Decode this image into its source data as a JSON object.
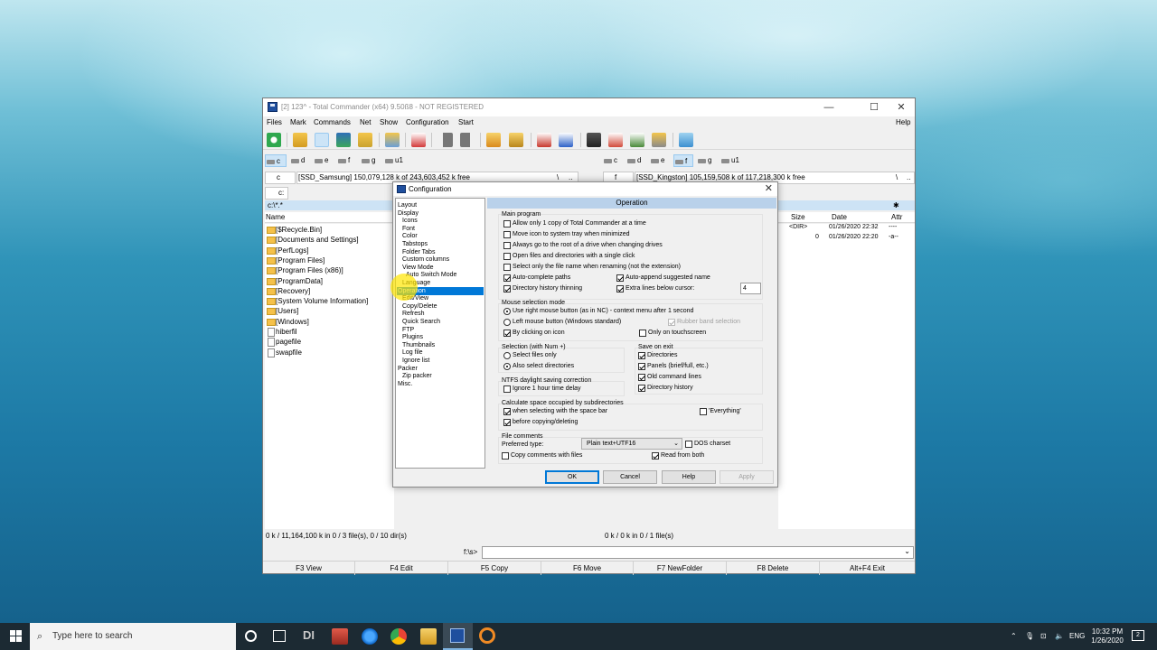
{
  "window": {
    "title": "[2] 123^ - Total Commander (x64) 9.50ß8 - NOT REGISTERED",
    "min_glyph": "—",
    "max_glyph": "☐",
    "close_glyph": "✕"
  },
  "menu": [
    "Files",
    "Mark",
    "Commands",
    "Net",
    "Show",
    "Configuration",
    "Start"
  ],
  "menu_help": "Help",
  "left_drives": [
    "c",
    "d",
    "e",
    "f",
    "g",
    "u1"
  ],
  "right_drives": [
    "c",
    "d",
    "e",
    "f",
    "g",
    "u1"
  ],
  "left_panel": {
    "drive_select": "c",
    "info": "[SSD_Samsung]  150,079,128 k of 243,603,452 k free",
    "root_btn": "\\",
    "up_btn": "..",
    "tab": "c:",
    "path": "c:\\*.*",
    "col_name": "Name",
    "files": [
      {
        "name": "[$Recycle.Bin]",
        "kind": "dir"
      },
      {
        "name": "[Documents and Settings]",
        "kind": "dir"
      },
      {
        "name": "[PerfLogs]",
        "kind": "dir"
      },
      {
        "name": "[Program Files]",
        "kind": "dir"
      },
      {
        "name": "[Program Files (x86)]",
        "kind": "dir"
      },
      {
        "name": "[ProgramData]",
        "kind": "dir"
      },
      {
        "name": "[Recovery]",
        "kind": "dir"
      },
      {
        "name": "[System Volume Information]",
        "kind": "dir"
      },
      {
        "name": "[Users]",
        "kind": "dir"
      },
      {
        "name": "[Windows]",
        "kind": "dir"
      },
      {
        "name": "hiberfil",
        "kind": "file"
      },
      {
        "name": "pagefile",
        "kind": "file"
      },
      {
        "name": "swapfile",
        "kind": "file"
      }
    ],
    "status": "0 k / 11,164,100 k in 0 / 3 file(s), 0 / 10 dir(s)"
  },
  "right_panel": {
    "drive_select": "f",
    "info": "[SSD_Kingston]  105,159,508 k of 117,218,300 k free",
    "root_btn": "\\",
    "up_btn": "..",
    "star": "✱",
    "col_size": "Size",
    "col_date": "Date",
    "col_attr": "Attr",
    "rows": [
      {
        "size": "<DIR>",
        "date": "01/26/2020 22:32",
        "attr": "----"
      },
      {
        "size": "0",
        "date": "01/26/2020 22:20",
        "attr": "-a--"
      }
    ],
    "status": "0 k / 0 k in 0 / 1 file(s)"
  },
  "command_prompt": "f:\\s>",
  "fn_keys": [
    "F3 View",
    "F4 Edit",
    "F5 Copy",
    "F6 Move",
    "F7 NewFolder",
    "F8 Delete",
    "Alt+F4 Exit"
  ],
  "dialog": {
    "title": "Configuration",
    "close_glyph": "✕",
    "tree": [
      {
        "label": "Layout",
        "level": 0
      },
      {
        "label": "Display",
        "level": 0
      },
      {
        "label": "Icons",
        "level": 1
      },
      {
        "label": "Font",
        "level": 1
      },
      {
        "label": "Color",
        "level": 1
      },
      {
        "label": "Tabstops",
        "level": 1
      },
      {
        "label": "Folder Tabs",
        "level": 1
      },
      {
        "label": "Custom columns",
        "level": 1
      },
      {
        "label": "View Mode",
        "level": 1
      },
      {
        "label": "Auto Switch Mode",
        "level": 2
      },
      {
        "label": "Language",
        "level": 1
      },
      {
        "label": "Operation",
        "level": 0,
        "selected": true
      },
      {
        "label": "Edit/View",
        "level": 1
      },
      {
        "label": "Copy/Delete",
        "level": 1
      },
      {
        "label": "Refresh",
        "level": 1
      },
      {
        "label": "Quick Search",
        "level": 1
      },
      {
        "label": "FTP",
        "level": 1
      },
      {
        "label": "Plugins",
        "level": 1
      },
      {
        "label": "Thumbnails",
        "level": 1
      },
      {
        "label": "Log file",
        "level": 1
      },
      {
        "label": "Ignore list",
        "level": 1
      },
      {
        "label": "Packer",
        "level": 0
      },
      {
        "label": "Zip packer",
        "level": 1
      },
      {
        "label": "Misc.",
        "level": 0
      }
    ],
    "header": "Operation",
    "main_program": {
      "title": "Main program",
      "allow_one_copy": "Allow only 1 copy of Total Commander at a time",
      "tray": "Move icon to system tray when minimized",
      "root": "Always go to the root of a drive when changing drives",
      "single_click": "Open files and directories with a single click",
      "select_name": "Select only the file name when renaming (not the extension)",
      "autocomplete": "Auto-complete paths",
      "append_name": "Auto-append suggested name",
      "history_thin": "Directory history thinning",
      "extra_lines": "Extra lines below cursor:",
      "extra_lines_value": "4"
    },
    "mouse": {
      "title": "Mouse selection mode",
      "right": "Use right mouse button (as in NC) - context menu after 1 second",
      "left": "Left mouse button (Windows standard)",
      "rubber": "Rubber band selection",
      "click_icon": "By clicking on icon",
      "touch": "Only on touchscreen"
    },
    "num_selection": {
      "title": "Selection (with Num +)",
      "files_only": "Select files only",
      "dirs_too": "Also select directories"
    },
    "save_on_exit": {
      "title": "Save on exit",
      "dirs": "Directories",
      "panels": "Panels (brief/full, etc.)",
      "cmdlines": "Old command lines",
      "dirhist": "Directory history"
    },
    "ntfs": {
      "title": "NTFS daylight saving correction",
      "ignore": "Ignore 1 hour time delay"
    },
    "space": {
      "title": "Calculate space occupied by subdirectories",
      "spacebar": "when selecting with the space bar",
      "before_copy": "before copying/deleting",
      "everything": "'Everything'"
    },
    "comments": {
      "title": "File comments",
      "preferred": "Preferred type:",
      "type_value": "Plain text+UTF16",
      "dos": "DOS charset",
      "copy": "Copy comments with files",
      "read_both": "Read from both"
    },
    "buttons": {
      "ok": "OK",
      "cancel": "Cancel",
      "help": "Help",
      "apply": "Apply"
    }
  },
  "taskbar": {
    "search_placeholder": "Type here to search",
    "lang": "ENG",
    "time": "10:32 PM",
    "date": "1/26/2020",
    "notif_count": "2",
    "dl_label": "DI"
  }
}
